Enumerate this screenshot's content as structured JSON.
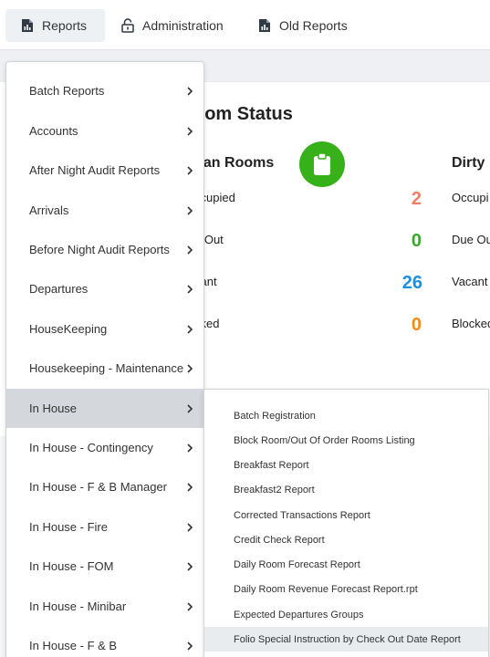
{
  "nav": {
    "reports": "Reports",
    "administration": "Administration",
    "old_reports": "Old Reports"
  },
  "background": {
    "title_fragment": "oom Status",
    "clean_heading": "ean Rooms",
    "dirty_heading": "Dirty",
    "rows": [
      {
        "label": "ccupied",
        "value": "2",
        "color": "#f07d64"
      },
      {
        "label": "e Out",
        "value": "0",
        "color": "#36a82a"
      },
      {
        "label": "cant",
        "value": "26",
        "color": "#1e8fdc"
      },
      {
        "label": "cked",
        "value": "0",
        "color": "#f08a1c"
      }
    ],
    "dirty_rows": [
      "Occupi",
      "Due Ou",
      "Vacant",
      "Blocked"
    ]
  },
  "menu": {
    "items": [
      {
        "label": "Batch Reports"
      },
      {
        "label": "Accounts"
      },
      {
        "label": "After Night Audit Reports"
      },
      {
        "label": "Arrivals"
      },
      {
        "label": "Before Night Audit Reports"
      },
      {
        "label": "Departures"
      },
      {
        "label": "HouseKeeping"
      },
      {
        "label": "Housekeeping - Maintenance"
      },
      {
        "label": "In House"
      },
      {
        "label": "In House - Contingency"
      },
      {
        "label": "In House - F & B Manager"
      },
      {
        "label": "In House - Fire"
      },
      {
        "label": "In House - FOM"
      },
      {
        "label": "In House - Minibar"
      },
      {
        "label": "In House - F & B"
      }
    ],
    "active": "In House"
  },
  "submenu": {
    "items": [
      {
        "label": "Batch Registration"
      },
      {
        "label": "Block Room/Out Of Order Rooms Listing"
      },
      {
        "label": "Breakfast Report"
      },
      {
        "label": "Breakfast2 Report"
      },
      {
        "label": "Corrected Transactions Report"
      },
      {
        "label": "Credit Check Report"
      },
      {
        "label": "Daily Room Forecast Report"
      },
      {
        "label": "Daily Room Revenue Forecast Report.rpt"
      },
      {
        "label": "Expected Departures Groups"
      },
      {
        "label": "Folio Special Instruction by Check Out Date Report"
      }
    ],
    "hovered": "Folio Special Instruction by Check Out Date Report"
  },
  "colors": {
    "accent_green": "#36b11a",
    "active_bg": "#d4d8dc"
  }
}
